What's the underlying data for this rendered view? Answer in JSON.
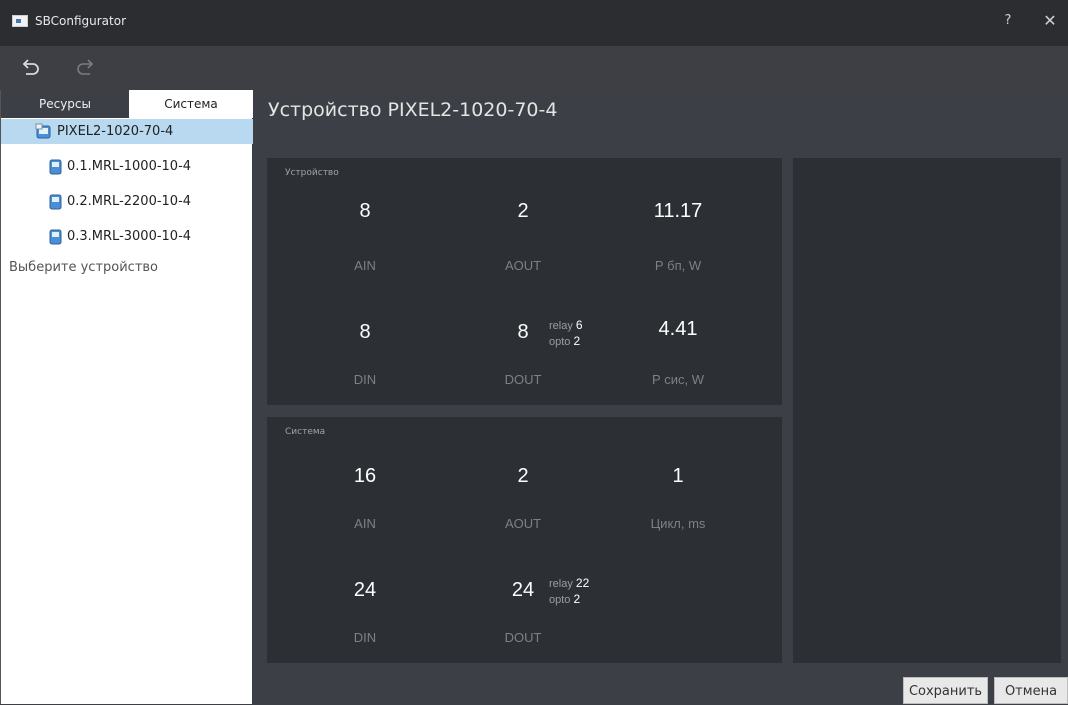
{
  "window": {
    "title": "SBConfigurator",
    "help": "?",
    "close": "✕"
  },
  "toolbar": {
    "undo_icon": "undo-icon",
    "redo_icon": "redo-icon"
  },
  "sidebar": {
    "tabs": [
      {
        "label": "Ресурсы",
        "active": false
      },
      {
        "label": "Система",
        "active": true
      }
    ],
    "tree": [
      {
        "label": "PIXEL2-1020-70-4",
        "selected": true
      },
      {
        "label": "0.1.MRL-1000-10-4"
      },
      {
        "label": "0.2.MRL-2200-10-4"
      },
      {
        "label": "0.3.MRL-3000-10-4"
      }
    ],
    "hint": "Выберите устройство"
  },
  "main": {
    "title": "Устройство PIXEL2-1020-70-4",
    "device_panel": {
      "caption": "Устройство",
      "ain": {
        "value": "8",
        "label": "AIN"
      },
      "aout": {
        "value": "2",
        "label": "AOUT"
      },
      "p_bp": {
        "value": "11.17",
        "label": "Р бп, W"
      },
      "din": {
        "value": "8",
        "label": "DIN"
      },
      "dout": {
        "value": "8",
        "label": "DOUT",
        "relay_label": "relay",
        "relay": "6",
        "opto_label": "opto",
        "opto": "2"
      },
      "p_sys": {
        "value": "4.41",
        "label": "Р сис, W"
      }
    },
    "system_panel": {
      "caption": "Система",
      "ain": {
        "value": "16",
        "label": "AIN"
      },
      "aout": {
        "value": "2",
        "label": "AOUT"
      },
      "cycle": {
        "value": "1",
        "label": "Цикл, ms"
      },
      "din": {
        "value": "24",
        "label": "DIN"
      },
      "dout": {
        "value": "24",
        "label": "DOUT",
        "relay_label": "relay",
        "relay": "22",
        "opto_label": "opto",
        "opto": "2"
      }
    }
  },
  "footer": {
    "save": "Сохранить",
    "cancel": "Отмена"
  },
  "colors": {
    "background": "#3c3f45",
    "panel": "#2c2f34",
    "titlebar": "#2b2d31",
    "selection": "#b8d9f0"
  }
}
